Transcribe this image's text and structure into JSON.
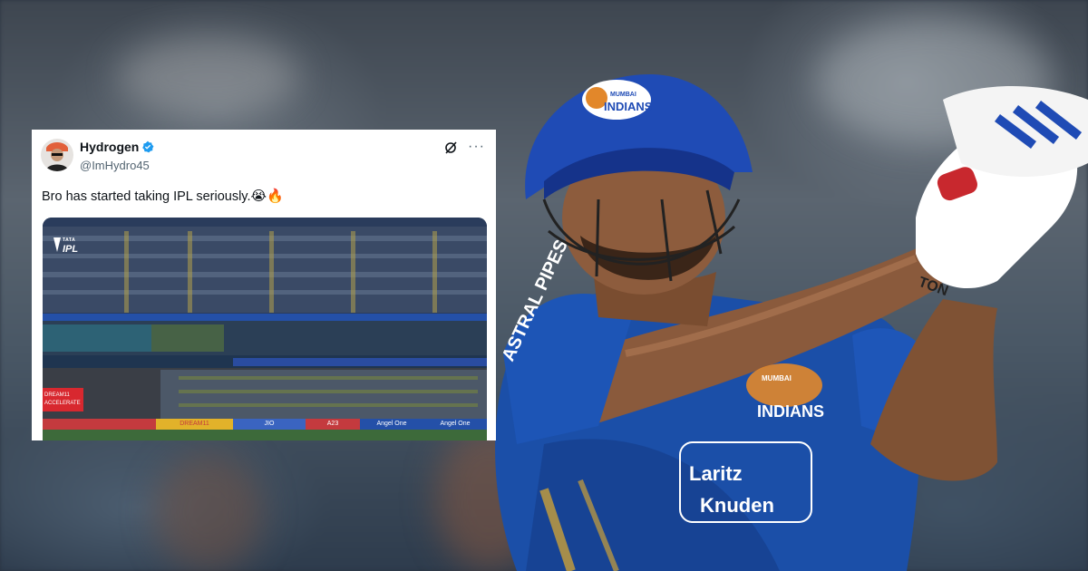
{
  "tweet": {
    "display_name": "Hydrogen",
    "handle": "@ImHydro45",
    "text": "Bro has started taking IPL seriously.",
    "text_emojis": "😭🔥",
    "more_label": "···",
    "icons": [
      "verified-badge-icon",
      "grok-icon",
      "more-icon"
    ],
    "media": {
      "logo_top": "TATA",
      "logo_main": "IPL",
      "banner_text": "DREAM11 ACCELERATE",
      "hoardings": [
        "DREAM11",
        "JIO",
        "A23",
        "Angel One",
        "Angel One"
      ]
    }
  },
  "player": {
    "helmet_logo_line1": "MUMBAI",
    "helmet_logo_line2": "INDIANS",
    "chest_logo_line1": "MUMBAI",
    "chest_logo_line2": "INDIANS",
    "sponsor_line1": "Laritz",
    "sponsor_line2": "Knuden",
    "sleeve_text": "ASTRAL PIPES",
    "bat_text": "TON"
  },
  "colors": {
    "mi_blue": "#1b4fa8",
    "helmet_blue": "#1f4bb5",
    "tweet_bg": "#ffffff",
    "verified": "#1d9bf0"
  }
}
